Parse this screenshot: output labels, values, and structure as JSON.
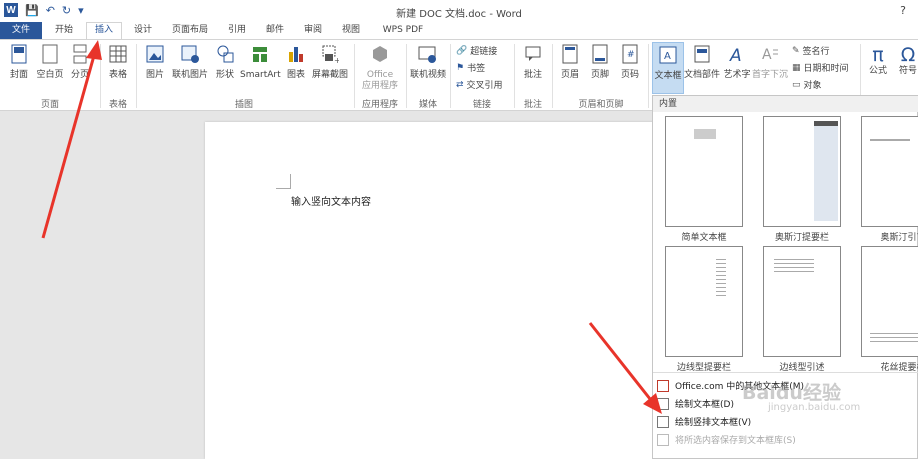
{
  "app": {
    "title": "新建 DOC 文档.doc - Word",
    "help": "?",
    "qat": {
      "save": "💾",
      "undo": "↶",
      "redo": "↻",
      "more": "▾"
    }
  },
  "tabs": [
    "文件",
    "开始",
    "插入",
    "设计",
    "页面布局",
    "引用",
    "邮件",
    "审阅",
    "视图",
    "WPS PDF"
  ],
  "ribbon": {
    "cover": "封面",
    "blank": "空白页",
    "break": "分页",
    "table": "表格",
    "picture": "图片",
    "online_picture": "联机图片",
    "shapes": "形状",
    "smartart": "SmartArt",
    "chart": "图表",
    "screenshot": "屏幕截图",
    "office_apps_line1": "Office",
    "office_apps_line2": "应用程序",
    "online_video": "联机视频",
    "hyperlink": "超链接",
    "bookmark": "书签",
    "crossref": "交叉引用",
    "comment": "批注",
    "header": "页眉",
    "footer": "页脚",
    "page_number": "页码",
    "textbox": "文本框",
    "quickparts": "文档部件",
    "wordart": "艺术字",
    "dropcap": "首字下沉",
    "signature": "签名行",
    "datetime": "日期和时间",
    "object": "对象",
    "equation": "公式",
    "symbol": "符号"
  },
  "groups": {
    "pages": "页面",
    "tables": "表格",
    "illustrations": "插图",
    "apps": "应用程序",
    "media": "媒体",
    "links": "链接",
    "comments": "批注",
    "header_footer": "页眉和页脚"
  },
  "document": {
    "text": "输入竖向文本内容"
  },
  "textbox_panel": {
    "heading": "内置",
    "thumbnails": [
      "简单文本框",
      "奥斯汀提要栏",
      "奥斯汀引言",
      "边线型提要栏",
      "边线型引述",
      "花丝提要栏"
    ],
    "menu": [
      "Office.com 中的其他文本框(M)",
      "绘制文本框(D)",
      "绘制竖排文本框(V)",
      "将所选内容保存到文本框库(S)"
    ]
  },
  "watermark": {
    "brand": "Baidu经验",
    "url": "jingyan.baidu.com"
  },
  "colors": {
    "accent": "#2b579a",
    "arrow": "#e8342a"
  }
}
